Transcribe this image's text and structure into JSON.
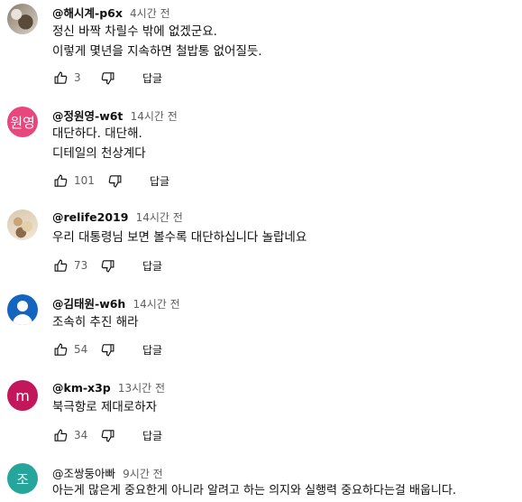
{
  "comments": [
    {
      "handle": "@해시계-p6x",
      "time": "4시간 전",
      "avatar_type": "photo",
      "avatar_text": "",
      "avatar_color": "",
      "lines": [
        "정신 바짝 차릴수 밖에  없겠군요.",
        "이렇게 몇년을 지속하면 철밥통 없어질듯."
      ],
      "likes": "3",
      "reply_label": "답글"
    },
    {
      "handle": "@정원영-w6t",
      "time": "14시간 전",
      "avatar_type": "letter",
      "avatar_text": "원영",
      "avatar_color": "#e8467c",
      "lines": [
        "대단하다. 대단해.",
        "디테일의 천상계다"
      ],
      "likes": "101",
      "reply_label": "답글"
    },
    {
      "handle": "@relife2019",
      "time": "14시간 전",
      "avatar_type": "photo",
      "avatar_text": "",
      "avatar_color": "",
      "lines": [
        "우리 대통령님 보면 볼수록 대단하십니다 놀랍네요"
      ],
      "likes": "73",
      "reply_label": "답글"
    },
    {
      "handle": "@김태원-w6h",
      "time": "14시간 전",
      "avatar_type": "person",
      "avatar_text": "",
      "avatar_color": "#1565c0",
      "lines": [
        "조속히 추진 해라"
      ],
      "likes": "54",
      "reply_label": "답글"
    },
    {
      "handle": "@km-x3p",
      "time": "13시간 전",
      "avatar_type": "letter",
      "avatar_text": "m",
      "avatar_color": "#c2185b",
      "lines": [
        "북극항로 제대로하자"
      ],
      "likes": "34",
      "reply_label": "답글"
    },
    {
      "handle": "@조쌍둥아빠",
      "time": "9시간 전",
      "avatar_type": "letter",
      "avatar_text": "조",
      "avatar_color": "#26a69a",
      "lines": [
        "아는게 많은게 중요한게 아니라 알려고 하는 의지와 실행력 중요하다는걸 배웁니다."
      ],
      "likes": "",
      "reply_label": ""
    }
  ],
  "icons": {
    "like": "thumb-up-icon",
    "dislike": "thumb-down-icon"
  }
}
